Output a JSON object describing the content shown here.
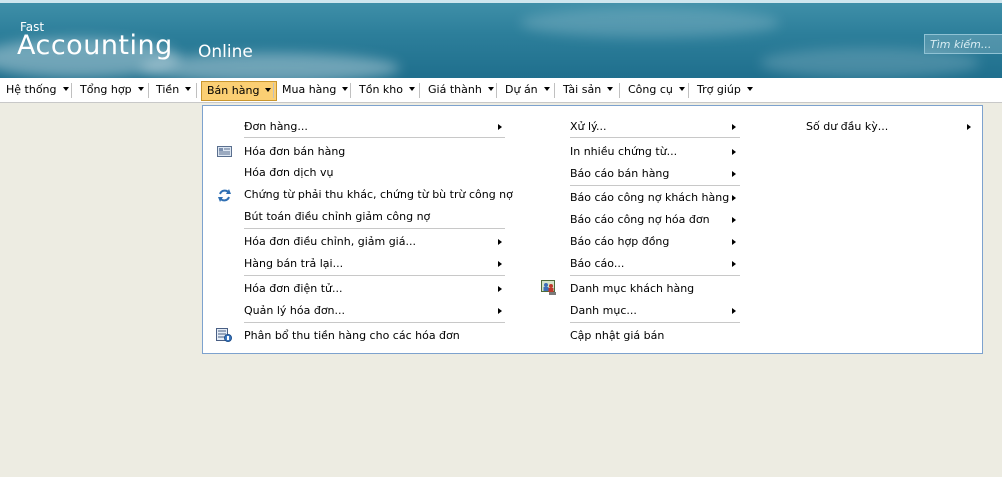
{
  "logo": {
    "line1": "Fast",
    "line2": "Accounting",
    "line3": "Online"
  },
  "search": {
    "placeholder": "Tìm kiếm..."
  },
  "menu": [
    {
      "label": "Hệ thống"
    },
    {
      "label": "Tổng hợp"
    },
    {
      "label": "Tiền"
    },
    {
      "label": "Bán hàng"
    },
    {
      "label": "Mua hàng"
    },
    {
      "label": "Tồn kho"
    },
    {
      "label": "Giá thành"
    },
    {
      "label": "Dự án"
    },
    {
      "label": "Tài sản"
    },
    {
      "label": "Công cụ"
    },
    {
      "label": "Trợ giúp"
    }
  ],
  "dropdown": {
    "col1": [
      {
        "label": "Đơn hàng..."
      },
      {
        "label": "Hóa đơn bán hàng",
        "icon": "invoice-icon"
      },
      {
        "label": "Hóa đơn dịch vụ"
      },
      {
        "label": "Chứng từ phải thu khác, chứng từ bù trừ công nợ",
        "icon": "refresh-icon"
      },
      {
        "label": "Bút toán điều chỉnh giảm công nợ"
      },
      {
        "label": "Hóa đơn điều chỉnh, giảm giá..."
      },
      {
        "label": "Hàng bán trả lại..."
      },
      {
        "label": "Hóa đơn điện tử..."
      },
      {
        "label": "Quản lý hóa đơn..."
      },
      {
        "label": "Phân bổ thu tiền hàng cho các hóa đơn",
        "icon": "allocate-icon"
      }
    ],
    "col2": [
      {
        "label": "Xử lý..."
      },
      {
        "label": "In nhiều chứng từ..."
      },
      {
        "label": "Báo cáo bán hàng"
      },
      {
        "label": "Báo cáo công nợ khách hàng"
      },
      {
        "label": "Báo cáo công nợ hóa đơn"
      },
      {
        "label": "Báo cáo hợp đồng"
      },
      {
        "label": "Báo cáo..."
      },
      {
        "label": "Danh mục khách hàng",
        "icon": "customers-icon"
      },
      {
        "label": "Danh mục..."
      },
      {
        "label": "Cập nhật giá bán"
      }
    ],
    "col3": [
      {
        "label": "Số dư đầu kỳ..."
      }
    ]
  },
  "colors": {
    "header": "#2d7f9b",
    "active_menu": "#fbcf73",
    "dropdown_border": "#7da2ce",
    "background": "#edece2"
  }
}
